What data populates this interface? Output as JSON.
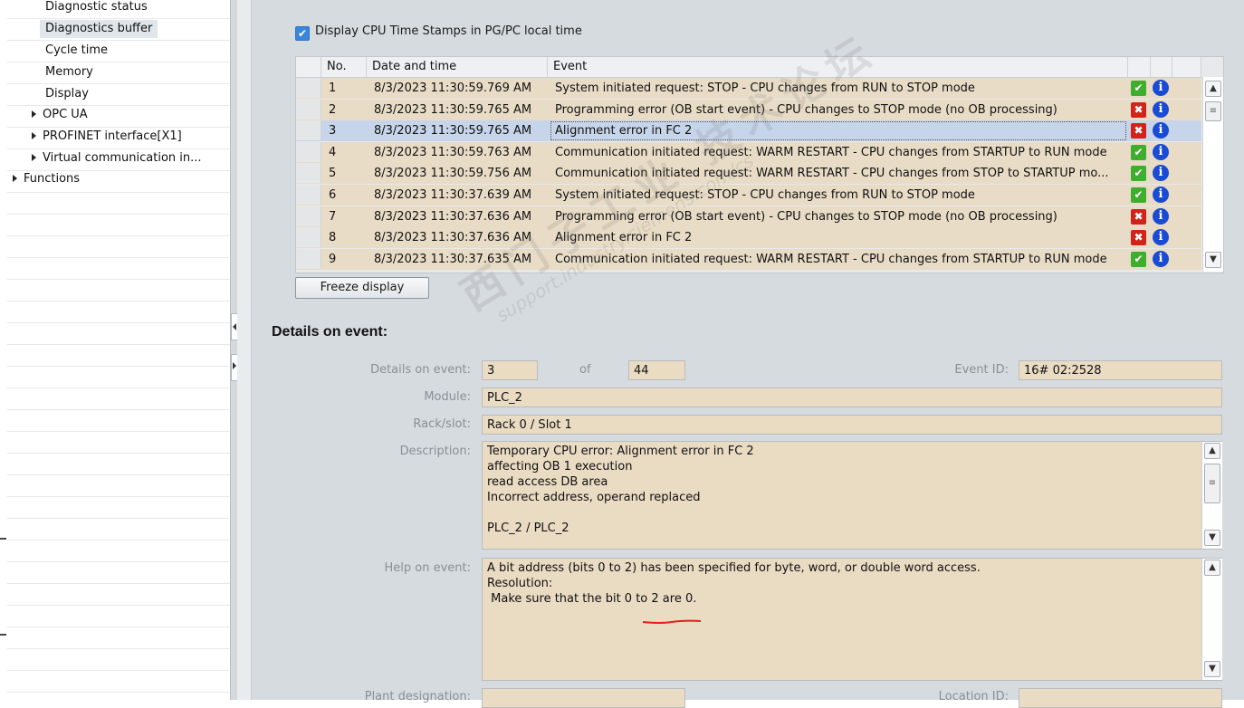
{
  "nav": {
    "items": [
      {
        "label": "Diagnostic status",
        "expandable": false,
        "indent": 2,
        "selected": false
      },
      {
        "label": "Diagnostics buffer",
        "expandable": false,
        "indent": 2,
        "selected": true
      },
      {
        "label": "Cycle time",
        "expandable": false,
        "indent": 2,
        "selected": false
      },
      {
        "label": "Memory",
        "expandable": false,
        "indent": 2,
        "selected": false
      },
      {
        "label": "Display",
        "expandable": false,
        "indent": 2,
        "selected": false
      },
      {
        "label": "OPC UA",
        "expandable": true,
        "indent": 1,
        "selected": false
      },
      {
        "label": "PROFINET interface[X1]",
        "expandable": true,
        "indent": 1,
        "selected": false
      },
      {
        "label": "Virtual communication in...",
        "expandable": true,
        "indent": 1,
        "selected": false
      },
      {
        "label": "Functions",
        "expandable": true,
        "indent": 0,
        "selected": false
      }
    ]
  },
  "toolbar": {
    "timestamp_checkbox_label": "Display CPU Time Stamps in PG/PC local time",
    "timestamp_checked": true,
    "freeze_label": "Freeze display"
  },
  "buffer": {
    "columns": {
      "no": "No.",
      "datetime": "Date and time",
      "event": "Event"
    },
    "rows": [
      {
        "no": "1",
        "datetime": "8/3/2023 11:30:59.769 AM",
        "event": "System initiated request: STOP  - CPU changes from RUN to STOP mode",
        "status": "ok",
        "selected": false
      },
      {
        "no": "2",
        "datetime": "8/3/2023 11:30:59.765 AM",
        "event": "Programming error (OB start event)  - CPU changes to STOP mode (no OB processing)",
        "status": "error",
        "selected": false
      },
      {
        "no": "3",
        "datetime": "8/3/2023 11:30:59.765 AM",
        "event": "Alignment error in FC 2",
        "status": "error",
        "selected": true
      },
      {
        "no": "4",
        "datetime": "8/3/2023 11:30:59.763 AM",
        "event": "Communication initiated request: WARM RESTART - CPU changes from STARTUP to RUN mode",
        "status": "ok",
        "selected": false
      },
      {
        "no": "5",
        "datetime": "8/3/2023 11:30:59.756 AM",
        "event": "Communication initiated request: WARM RESTART - CPU changes from STOP to STARTUP mo...",
        "status": "ok",
        "selected": false
      },
      {
        "no": "6",
        "datetime": "8/3/2023 11:30:37.639 AM",
        "event": "System initiated request: STOP  - CPU changes from RUN to STOP mode",
        "status": "ok",
        "selected": false
      },
      {
        "no": "7",
        "datetime": "8/3/2023 11:30:37.636 AM",
        "event": "Programming error (OB start event)  - CPU changes to STOP mode (no OB processing)",
        "status": "error",
        "selected": false
      },
      {
        "no": "8",
        "datetime": "8/3/2023 11:30:37.636 AM",
        "event": "Alignment error in FC 2",
        "status": "error",
        "selected": false
      },
      {
        "no": "9",
        "datetime": "8/3/2023 11:30:37.635 AM",
        "event": "Communication initiated request: WARM RESTART - CPU changes from STARTUP to RUN mode",
        "status": "ok",
        "selected": false
      }
    ]
  },
  "details": {
    "title": "Details on event:",
    "labels": {
      "details_on_event": "Details on event:",
      "of": "of",
      "event_id": "Event ID:",
      "module": "Module:",
      "rack_slot": "Rack/slot:",
      "description": "Description:",
      "help": "Help on event:",
      "plant_designation": "Plant designation:",
      "location_id": "Location ID:"
    },
    "event_index": "3",
    "event_total": "44",
    "event_id": "16# 02:2528",
    "module": "PLC_2",
    "rack_slot": "Rack 0 / Slot 1",
    "description_lines": [
      "Temporary CPU error: Alignment error in FC 2",
      "affecting OB 1 execution",
      "read access DB area",
      "Incorrect address, operand replaced",
      "",
      "PLC_2 / PLC_2"
    ],
    "help_lines": [
      "A bit address (bits 0 to 2) has been specified for byte, word, or double word access.",
      "Resolution:",
      " Make sure that the bit 0 to 2 are 0."
    ]
  },
  "watermark": {
    "line1": "西门子工业 技术论坛",
    "line2": "support.industry.siemens.com/cs"
  },
  "colors": {
    "status_ok": "#3fae2e",
    "status_error": "#d2231b",
    "info": "#1a4bd4",
    "row_bg": "#e9dcc6",
    "row_selected": "#c6d5e9",
    "field_bg": "#eadbc3"
  },
  "icons": {
    "status_ok": "check-icon",
    "status_error": "wrench-error-icon",
    "info": "info-icon"
  }
}
